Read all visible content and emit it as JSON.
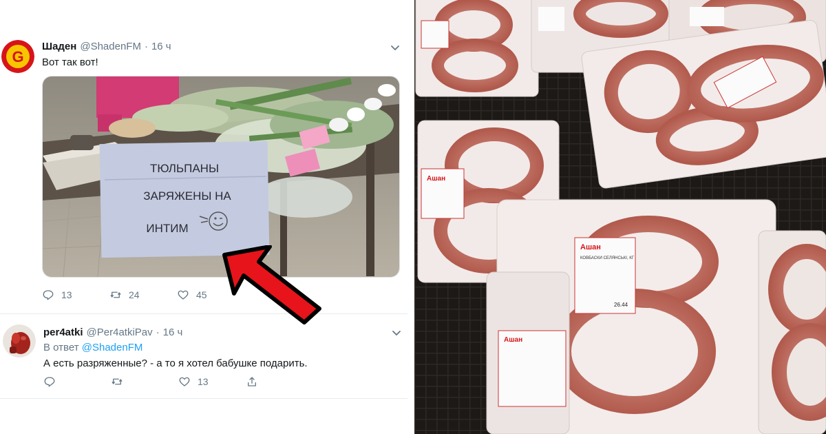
{
  "tweet_main": {
    "display_name": "Шаден",
    "handle": "@ShadenFM",
    "separator": "·",
    "time": "16 ч",
    "text": "Вот так вот!",
    "avatar_letter": "G",
    "image_sign": {
      "line1": "ТЮЛЬПАНЫ",
      "line2": "ЗАРЯЖЕНЫ НА",
      "line3": "ИНТИМ"
    },
    "actions": {
      "reply_count": "13",
      "retweet_count": "24",
      "like_count": "45"
    },
    "icons": [
      "chevron-down-icon",
      "reply-icon",
      "retweet-icon",
      "heart-icon"
    ]
  },
  "tweet_reply": {
    "display_name": "per4atki",
    "handle": "@Per4atkiPav",
    "separator": "·",
    "time": "16 ч",
    "reply_prefix": "В ответ",
    "reply_mention": "@ShadenFM",
    "text": "А есть разряженные? - а то я хотел бабушке подарить.",
    "actions": {
      "like_count": "13"
    },
    "icons": [
      "chevron-down-icon",
      "reply-icon",
      "retweet-icon",
      "heart-icon",
      "share-icon"
    ]
  },
  "photo_right": {
    "store_label": "Ашан",
    "product_label": "КОВБАСКИ СЕЛЯНСЬКІ, КГ",
    "price_tag": "26.44"
  },
  "colors": {
    "accent_blue": "#1da1f2",
    "muted_gray": "#657786",
    "arrow_red": "#e8141b"
  }
}
